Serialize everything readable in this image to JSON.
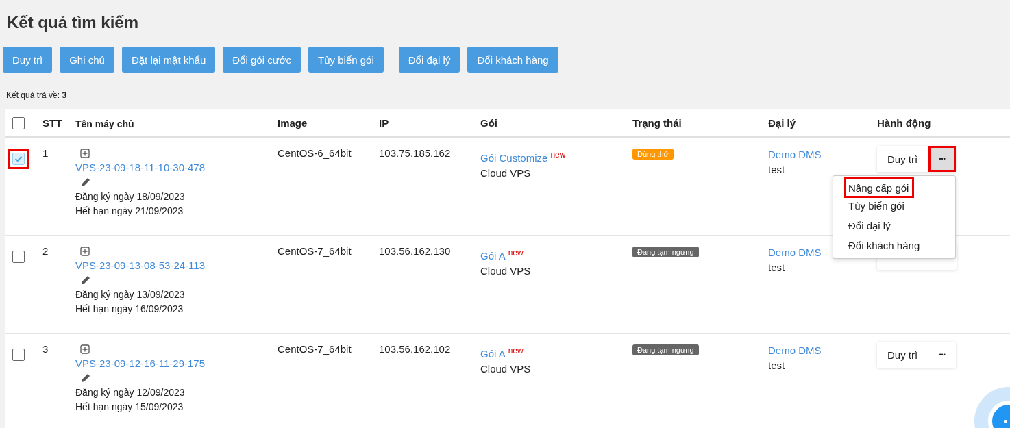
{
  "page_title": "Kết quả tìm kiếm",
  "toolbar_buttons": [
    "Duy trì",
    "Ghi chú",
    "Đặt lại mật khẩu",
    "Đổi gói cước",
    "Tùy biến gói",
    "Đổi đại lý",
    "Đổi khách hàng"
  ],
  "result_count": {
    "label": "Kết quả trả về:",
    "value": "3"
  },
  "table": {
    "select_all_checked": false,
    "columns": [
      "STT",
      "Tên máy chủ",
      "Image",
      "IP",
      "Gói",
      "Trạng thái",
      "Đại lý",
      "Hành động"
    ],
    "rows": [
      {
        "checked": true,
        "highlighted": true,
        "index": "1",
        "name": "VPS-23-09-18-11-10-30-478",
        "registered": "Đăng ký ngày 18/09/2023",
        "expires": "Hết hạn ngày 21/09/2023",
        "image": "CentOS-6_64bit",
        "ip": "103.75.185.162",
        "package": "Gói Customize",
        "package_badge": "new",
        "package_type": "Cloud VPS",
        "status": {
          "label": "Dùng thử",
          "color": "#ff9800"
        },
        "agent": "Demo DMS",
        "agent_user": "test",
        "action_button": "Duy trì",
        "more_button": "•••",
        "more_highlighted": true,
        "menu_open": true
      },
      {
        "checked": false,
        "highlighted": false,
        "index": "2",
        "name": "VPS-23-09-13-08-53-24-113",
        "registered": "Đăng ký ngày 13/09/2023",
        "expires": "Hết hạn ngày 16/09/2023",
        "image": "CentOS-7_64bit",
        "ip": "103.56.162.130",
        "package": "Gói A",
        "package_badge": "new",
        "package_type": "Cloud VPS",
        "status": {
          "label": "Đang tạm ngưng",
          "color": "#666666"
        },
        "agent": "Demo DMS",
        "agent_user": "test"
      },
      {
        "checked": false,
        "highlighted": false,
        "index": "3",
        "name": "VPS-23-09-12-16-11-29-175",
        "registered": "Đăng ký ngày 12/09/2023",
        "expires": "Hết hạn ngày 15/09/2023",
        "image": "CentOS-7_64bit",
        "ip": "103.56.162.102",
        "package": "Gói A",
        "package_badge": "new",
        "package_type": "Cloud VPS",
        "status": {
          "label": "Đang tạm ngưng",
          "color": "#666666"
        },
        "agent": "Demo DMS",
        "agent_user": "test",
        "action_button": "Duy trì",
        "more_button": "•••",
        "more_highlighted": false,
        "menu_open": false
      }
    ]
  },
  "dropdown_menu": [
    {
      "label": "Nâng cấp gói",
      "highlighted": true
    },
    {
      "label": "Tùy biến gói",
      "highlighted": false
    },
    {
      "label": "Đổi đại lý",
      "highlighted": false
    },
    {
      "label": "Đổi khách hàng",
      "highlighted": false
    }
  ]
}
